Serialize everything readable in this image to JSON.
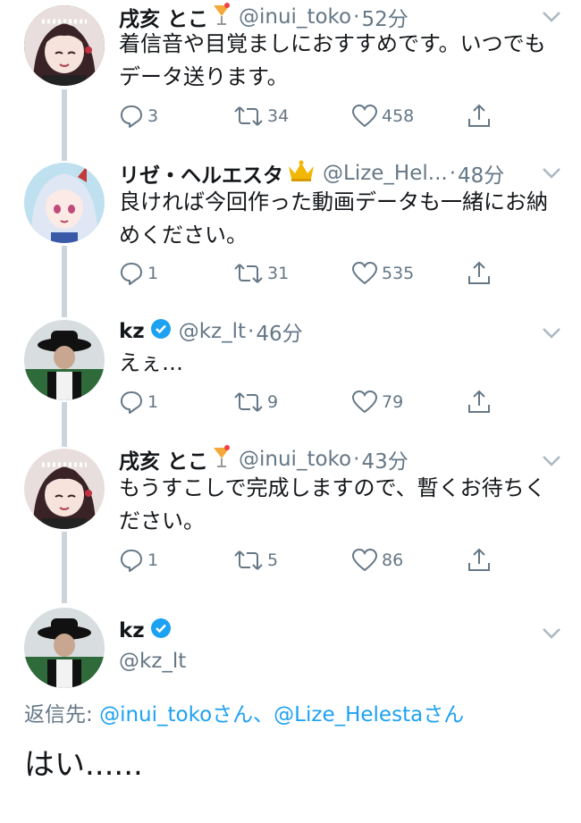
{
  "tweets": [
    {
      "name": "戌亥 とこ",
      "emoji": "🍹",
      "handle": "@inui_toko",
      "sep": "·",
      "time": "52分",
      "text_lines": [
        "着信音や目覚ましにおすすめです。いつでも",
        "データ送ります。"
      ],
      "replies": "3",
      "retweets": "34",
      "likes": "458"
    },
    {
      "name": "リゼ・ヘルエスタ",
      "emoji": "👑",
      "handle": "@Lize_Hel...",
      "sep": "·",
      "time": "48分",
      "text_lines": [
        "良ければ今回作った動画データも一緒にお納",
        "めください。"
      ],
      "replies": "1",
      "retweets": "31",
      "likes": "535"
    },
    {
      "name": "kz",
      "handle": "@kz_lt",
      "sep": "·",
      "time": "46分",
      "text_lines": [
        "えぇ…"
      ],
      "replies": "1",
      "retweets": "9",
      "likes": "79"
    },
    {
      "name": "戌亥 とこ",
      "emoji": "🍹",
      "handle": "@inui_toko",
      "sep": "·",
      "time": "43分",
      "text_lines": [
        "もうすこしで完成しますので、暫くお待ちく",
        "ださい。"
      ],
      "replies": "1",
      "retweets": "5",
      "likes": "86"
    }
  ],
  "main_tweet": {
    "name": "kz",
    "handle": "@kz_lt",
    "reply_prefix": "返信先: ",
    "mention1": "@inui_toko",
    "suffix1": "さん、",
    "mention2": "@Lize_Helesta",
    "suffix2": "さん",
    "text": "はい......"
  },
  "colors": {
    "link": "#1da1f2",
    "muted": "#657786",
    "verified": "#1da1f2",
    "thread": "#cdd5dc"
  },
  "icons": [
    "reply-icon",
    "retweet-icon",
    "like-icon",
    "share-icon",
    "chevron-down-icon",
    "verified-badge-icon"
  ]
}
